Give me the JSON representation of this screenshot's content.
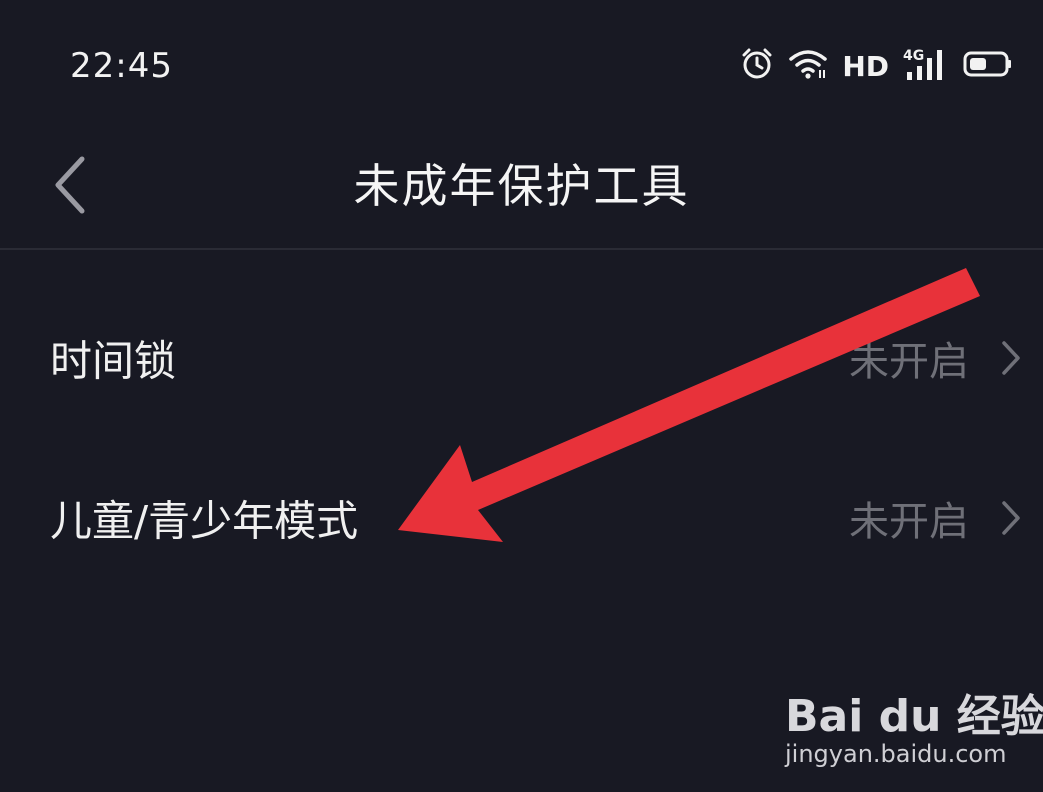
{
  "status_bar": {
    "time": "22:45",
    "hd_label": "HD",
    "network_label": "4G",
    "icons": [
      "alarm-icon",
      "wifi-icon",
      "signal-icon",
      "battery-icon"
    ]
  },
  "header": {
    "title": "未成年保护工具",
    "back_icon": "chevron-left-icon"
  },
  "settings": {
    "items": [
      {
        "label": "时间锁",
        "value": "未开启"
      },
      {
        "label": "儿童/青少年模式",
        "value": "未开启"
      }
    ]
  },
  "annotation": {
    "arrow_color": "#e8323a"
  },
  "watermark": {
    "logo": "Bai du 经验",
    "url": "jingyan.baidu.com"
  },
  "colors": {
    "background": "#181923",
    "text_primary": "#f0f0f0",
    "text_secondary": "#6f7078"
  }
}
